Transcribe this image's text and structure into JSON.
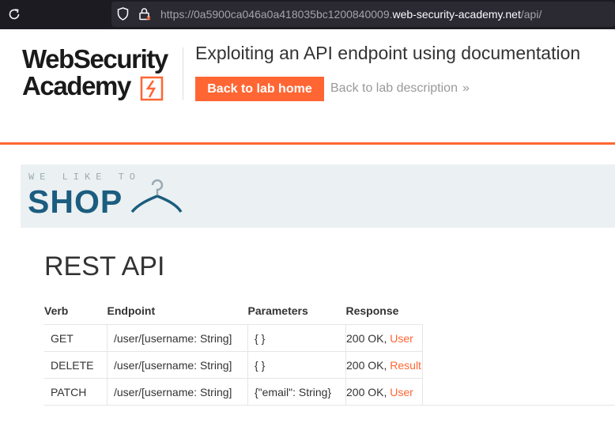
{
  "browser": {
    "url_prefix": "https://0a5900ca046a0a418035bc1200840009.",
    "url_host": "web-security-academy.net",
    "url_path": "/api/",
    "icons": [
      "reload-icon",
      "shield-icon",
      "lock-icon"
    ]
  },
  "header": {
    "logo_line1": "WebSecurity",
    "logo_line2": "Academy",
    "lab_title": "Exploiting an API endpoint using documentation",
    "back_home_label": "Back to lab home",
    "back_desc_label": "Back to lab description",
    "back_desc_chevron": "»",
    "accent_color": "#ff6633"
  },
  "shop_banner": {
    "tagline": "WE LIKE TO",
    "word": "SHOP",
    "icon": "hanger-icon",
    "word_color": "#1b5d7f"
  },
  "api": {
    "title": "REST API",
    "columns": [
      "Verb",
      "Endpoint",
      "Parameters",
      "Response"
    ],
    "rows": [
      {
        "verb": "GET",
        "endpoint": "/user/[username: String]",
        "params": "{ }",
        "status": "200 OK,",
        "type": "User"
      },
      {
        "verb": "DELETE",
        "endpoint": "/user/[username: String]",
        "params": "{ }",
        "status": "200 OK,",
        "type": "Result"
      },
      {
        "verb": "PATCH",
        "endpoint": "/user/[username: String]",
        "params": "{\"email\": String}",
        "status": "200 OK,",
        "type": "User"
      }
    ]
  }
}
